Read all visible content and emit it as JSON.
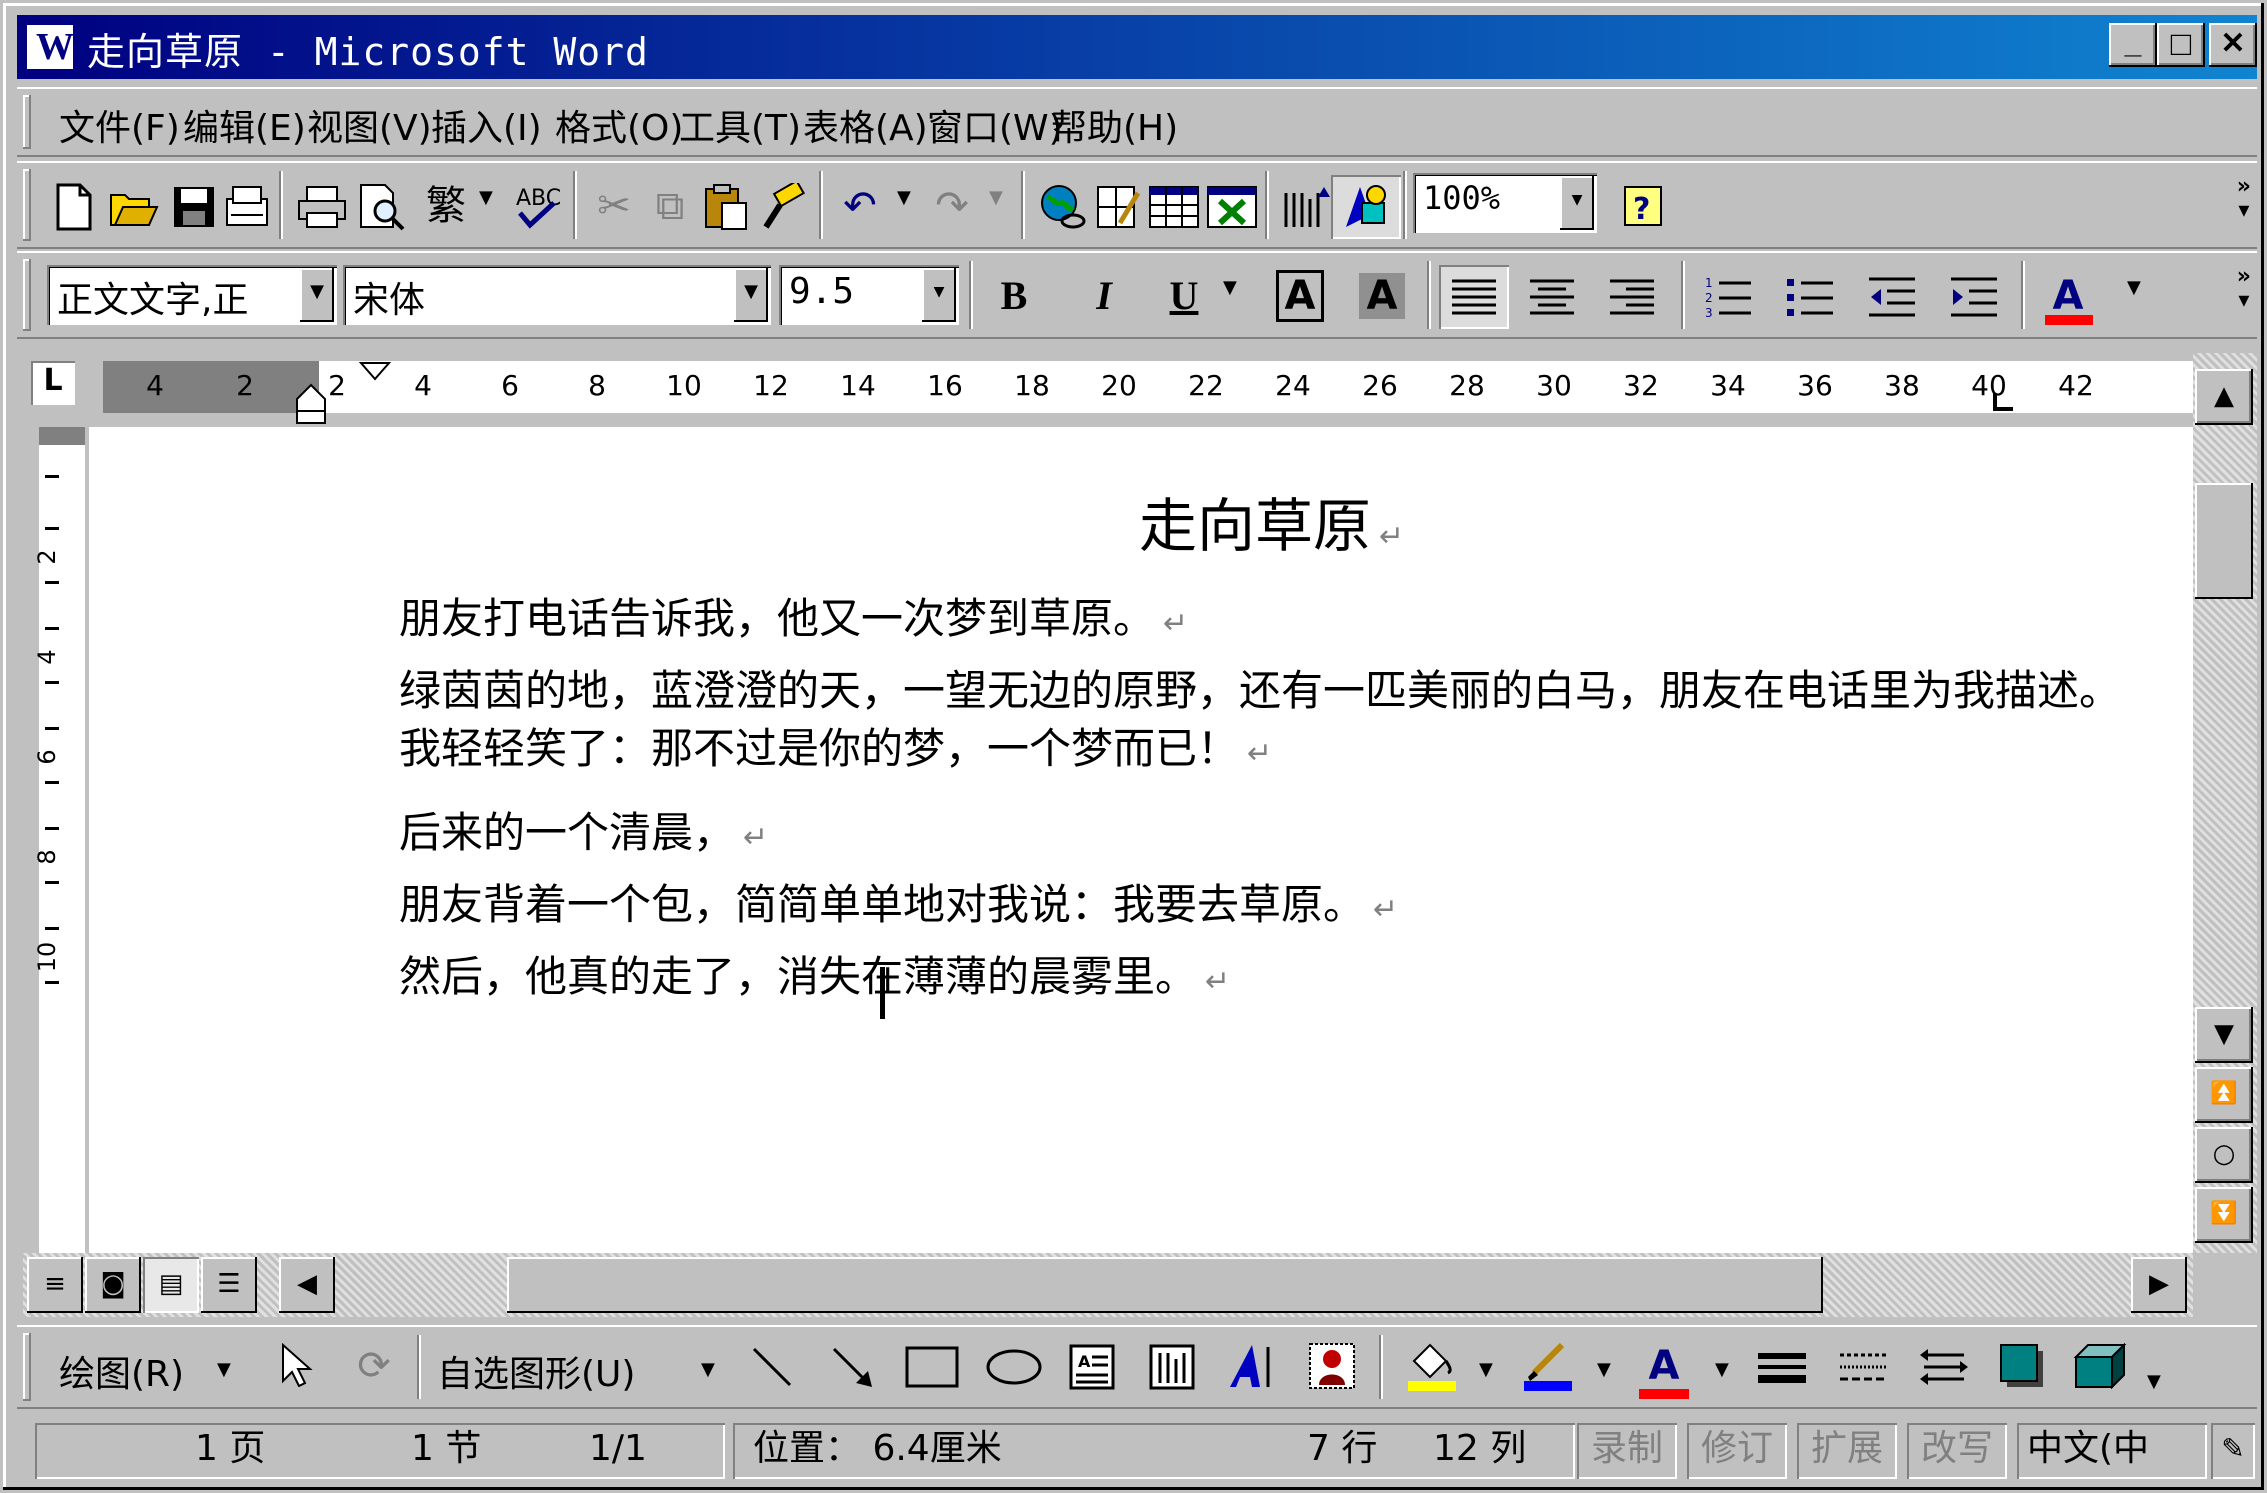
{
  "window": {
    "title": "走向草原 - Microsoft Word",
    "controls": {
      "minimize": "_",
      "maximize": "□",
      "close": "✕"
    }
  },
  "menu": [
    "文件(F)",
    "编辑(E)",
    "视图(V)",
    "插入(I)",
    "格式(O)",
    "工具(T)",
    "表格(A)",
    "窗口(W)",
    "帮助(H)"
  ],
  "standard_toolbar": {
    "icons": [
      "new-document",
      "open-folder",
      "save-disk",
      "email",
      "print",
      "print-preview",
      "traditional-chinese",
      "spelling",
      "cut",
      "copy",
      "paste",
      "format-painter",
      "undo",
      "redo",
      "web-hyperlink",
      "tables-borders",
      "insert-table",
      "insert-excel",
      "columns",
      "drawing",
      "help"
    ],
    "traditional_label": "繁",
    "zoom": "100%"
  },
  "formatting_toolbar": {
    "style": "正文文字,正",
    "font": "宋体",
    "size": "9.5",
    "bold": "B",
    "italic": "I",
    "underline": "U",
    "char_border": "A",
    "char_shading": "A",
    "font_color_label": "A",
    "colors": {
      "font_color": "#ff0000"
    }
  },
  "ruler": {
    "marks": [
      "4",
      "2",
      "2",
      "4",
      "6",
      "8",
      "10",
      "12",
      "14",
      "16",
      "18",
      "20",
      "22",
      "24",
      "26",
      "28",
      "30",
      "32",
      "34",
      "36",
      "38",
      "40",
      "42"
    ],
    "vertical_marks": [
      "2",
      "4",
      "6",
      "8",
      "10"
    ],
    "tab_selector": "L"
  },
  "document": {
    "title": "走向草原",
    "paragraphs": [
      "朋友打电话告诉我，他又一次梦到草原。",
      "绿茵茵的地，蓝澄澄的天，一望无边的原野，还有一匹美丽的白马，朋友在电话里为我描述。",
      "我轻轻笑了：那不过是你的梦，一个梦而已！",
      "后来的一个清晨，",
      "朋友背着一个包，简简单单地对我说：我要去草原。",
      "然后，他真的走了，消失在薄薄的晨雾里。"
    ],
    "paragraph_mark": "↵"
  },
  "drawing_toolbar": {
    "draw_label": "绘图(R)",
    "autoshapes_label": "自选图形(U)",
    "colors": {
      "fill": "#ffff00",
      "line": "#0000ff",
      "font": "#ff0000"
    }
  },
  "status_bar": {
    "page": "1 页",
    "section": "1 节",
    "page_of": "1/1",
    "position": "位置： 6.4厘米",
    "line": "7 行",
    "column": "12 列",
    "rec": "录制",
    "trk": "修订",
    "ext": "扩展",
    "ovr": "改写",
    "language": "中文(中"
  }
}
